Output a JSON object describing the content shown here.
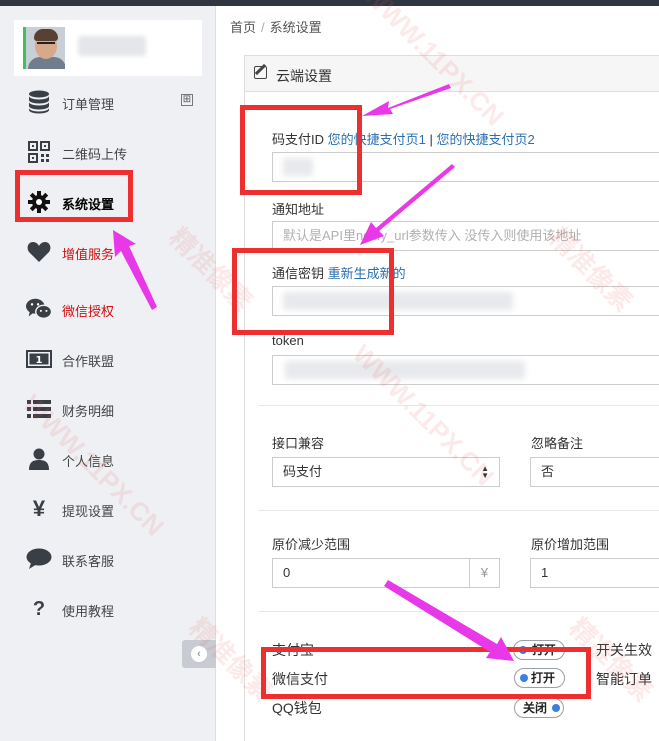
{
  "sidebar": {
    "items": [
      {
        "label": "订单管理",
        "icon": "database-icon",
        "expandable": true
      },
      {
        "label": "二维码上传",
        "icon": "qrcode-icon"
      },
      {
        "label": "系统设置",
        "icon": "gear-icon",
        "active": true
      },
      {
        "label": "增值服务",
        "icon": "heart-icon",
        "highlight": "red"
      },
      {
        "label": "微信授权",
        "icon": "wechat-icon",
        "highlight": "red"
      },
      {
        "label": "合作联盟",
        "icon": "money-icon"
      },
      {
        "label": "财务明细",
        "icon": "list-icon"
      },
      {
        "label": "个人信息",
        "icon": "user-icon"
      },
      {
        "label": "提现设置",
        "icon": "yen-icon"
      },
      {
        "label": "联系客服",
        "icon": "comment-icon"
      },
      {
        "label": "使用教程",
        "icon": "question-icon"
      }
    ],
    "expand_symbol": "⊞",
    "collapse_icon": "circle-arrow-left-icon"
  },
  "breadcrumb": {
    "home": "首页",
    "current": "系统设置",
    "separator": "/"
  },
  "panel": {
    "title": "云端设置",
    "code_pay": {
      "label": "码支付ID",
      "link1": "您的快捷支付页1",
      "sep": " | ",
      "link2": "您的快捷支付页2"
    },
    "notify": {
      "label": "通知地址",
      "placeholder": "默认是API里notify_url参数传入 没传入则使用该地址"
    },
    "secret": {
      "label": "通信密钥",
      "link": "重新生成新的"
    },
    "token": {
      "label": "token"
    },
    "compat": {
      "label": "接口兼容",
      "value": "码支付"
    },
    "ignore_remark": {
      "label": "忽略备注",
      "value": "否"
    },
    "reduce_range": {
      "label": "原价减少范围",
      "value": "0",
      "unit": "¥"
    },
    "increase_range": {
      "label": "原价增加范围",
      "value": "1"
    },
    "alipay": {
      "label": "支付宝",
      "toggle": "打开",
      "note": "开关生效"
    },
    "wechat_pay": {
      "label": "微信支付",
      "toggle": "打开",
      "note": "智能订单"
    },
    "qq_wallet": {
      "label": "QQ钱包",
      "toggle": "关闭"
    }
  },
  "colors": {
    "annotation_red": "#ee2f2f",
    "arrow_magenta": "#e838e8",
    "link_blue": "#2a6fb0",
    "toggle_dot": "#3d7fe0"
  }
}
